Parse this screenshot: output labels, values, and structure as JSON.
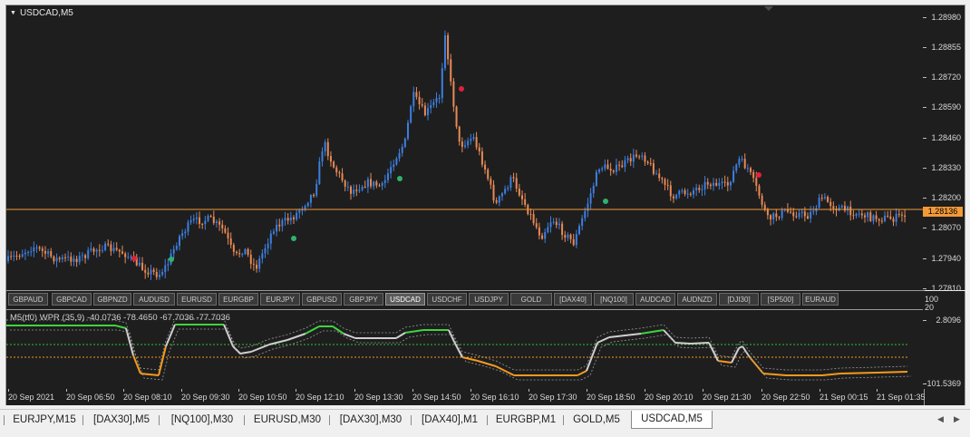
{
  "chart_title": "USDCAD,M5",
  "indicator_title": "M5(tf0) WPR (35,9) -40.0736 -78.4650 -67.7036 -77.7036",
  "price_axis": {
    "labels": [
      "1.28980",
      "1.28855",
      "1.28720",
      "1.28590",
      "1.28460",
      "1.28330",
      "1.28200",
      "1.28070",
      "1.27940",
      "1.27810"
    ],
    "current_price": "1.28136"
  },
  "indicator_axis": {
    "top_labels": [
      "100",
      "20"
    ],
    "labels": [
      "2.8096",
      "-101.5369"
    ]
  },
  "symbol_buttons": [
    {
      "label": "GBPAUD",
      "active": false
    },
    {
      "label": "GBPCAD",
      "active": false
    },
    {
      "label": "GBPNZD",
      "active": false
    },
    {
      "label": "AUDUSD",
      "active": false
    },
    {
      "label": "EURUSD",
      "active": false
    },
    {
      "label": "EURGBP",
      "active": false
    },
    {
      "label": "EURJPY",
      "active": false
    },
    {
      "label": "GBPUSD",
      "active": false
    },
    {
      "label": "GBPJPY",
      "active": false
    },
    {
      "label": "USDCAD",
      "active": true
    },
    {
      "label": "USDCHF",
      "active": false
    },
    {
      "label": "USDJPY",
      "active": false
    },
    {
      "label": "GOLD",
      "active": false
    },
    {
      "label": "[DAX40]",
      "active": false
    },
    {
      "label": "[NQ100]",
      "active": false
    },
    {
      "label": "AUDCAD",
      "active": false
    },
    {
      "label": "AUDNZD",
      "active": false
    },
    {
      "label": "[DJI30]",
      "active": false
    },
    {
      "label": "[SP500]",
      "active": false
    },
    {
      "label": "EURAUD",
      "active": false
    }
  ],
  "time_axis": [
    "20 Sep 2021",
    "20 Sep 06:50",
    "20 Sep 08:10",
    "20 Sep 09:30",
    "20 Sep 10:50",
    "20 Sep 12:10",
    "20 Sep 13:30",
    "20 Sep 14:50",
    "20 Sep 16:10",
    "20 Sep 17:30",
    "20 Sep 18:50",
    "20 Sep 20:10",
    "20 Sep 21:30",
    "20 Sep 22:50",
    "21 Sep 00:15",
    "21 Sep 01:35"
  ],
  "tabs": [
    {
      "label": "EURJPY,M15",
      "active": false
    },
    {
      "label": "[DAX30],M5",
      "active": false
    },
    {
      "label": "[NQ100],M30",
      "active": false
    },
    {
      "label": "EURUSD,M30",
      "active": false
    },
    {
      "label": "[DAX30],M30",
      "active": false
    },
    {
      "label": "[DAX40],M1",
      "active": false
    },
    {
      "label": "EURGBP,M1",
      "active": false
    },
    {
      "label": "GOLD,M5",
      "active": false
    },
    {
      "label": "USDCAD,M5",
      "active": true
    }
  ],
  "colors": {
    "background": "#1e1e1e",
    "bull_candle": "#3d7fe0",
    "bear_candle": "#e88a56",
    "price_line": "#f29938",
    "wpr_main": "#cfcfcf",
    "wpr_up": "#3ed43e",
    "wpr_down": "#f59a1c",
    "level_high": "#2ec12e",
    "level_low": "#f5961f",
    "signal_buy": "#2fb36b",
    "signal_sell": "#e0213c"
  },
  "icons": {
    "chart_menu": "triangle-down-icon",
    "tab_left": "triangle-left-icon",
    "tab_right": "triangle-right-icon"
  }
}
